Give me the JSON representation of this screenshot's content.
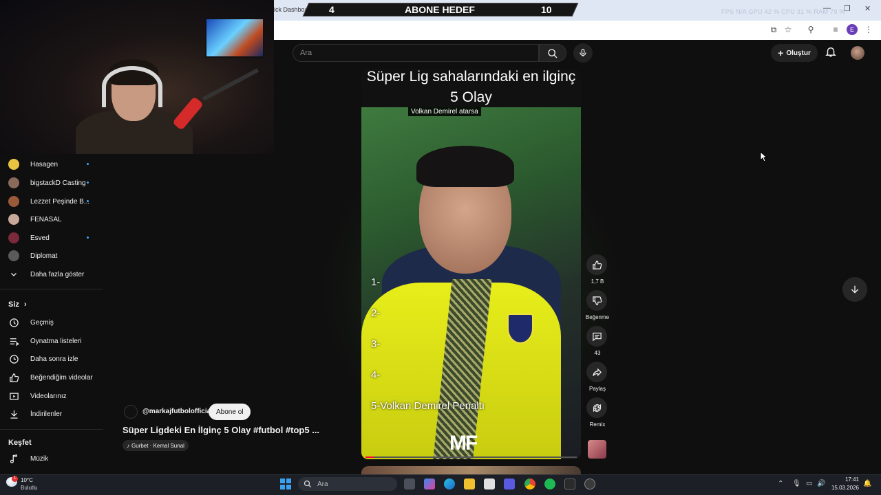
{
  "browser": {
    "tab_title": "ick Dashboard",
    "window_controls": [
      "—",
      "❐",
      "✕"
    ]
  },
  "overlay": {
    "abone": {
      "left": "4",
      "label": "ABONE HEDEF",
      "right": "10"
    },
    "perf": "FPS N/A    GPU 42 %    CPU 31 %    RAM 79 %"
  },
  "header": {
    "search_placeholder": "Ara",
    "create_label": "Oluştur"
  },
  "sidebar": {
    "subscriptions": [
      {
        "name": "Hasagen",
        "color": "#e8c440",
        "new": true
      },
      {
        "name": "bigstackD Casting",
        "color": "#8a6a5a",
        "new": true
      },
      {
        "name": "Lezzet Peşinde B...",
        "color": "#9a5a3a",
        "new": true
      },
      {
        "name": "FENASAL",
        "color": "#c8a89a",
        "new": false
      },
      {
        "name": "Esved",
        "color": "#7a2a3a",
        "new": true
      },
      {
        "name": "Diplomat",
        "color": "#5a5a5a",
        "new": false
      }
    ],
    "show_more": "Daha fazla göster",
    "you_heading": "Siz",
    "you_items": [
      {
        "label": "Geçmiş",
        "icon": "history-icon"
      },
      {
        "label": "Oynatma listeleri",
        "icon": "playlists-icon"
      },
      {
        "label": "Daha sonra izle",
        "icon": "watch-later-icon"
      },
      {
        "label": "Beğendiğim videolar",
        "icon": "liked-icon"
      },
      {
        "label": "Videolarınız",
        "icon": "your-videos-icon"
      },
      {
        "label": "İndirilenler",
        "icon": "downloads-icon"
      }
    ],
    "explore_heading": "Keşfet",
    "explore_items": [
      {
        "label": "Müzik",
        "icon": "music-icon"
      }
    ]
  },
  "short": {
    "title_line1": "Süper Lig sahalarındaki en ilginç",
    "title_line2": "5 Olay",
    "overlay_label": "Volkan Demirel atarsa",
    "ranks": [
      "1-",
      "2-",
      "3-",
      "4-",
      "5-Volkan Demirel Penaltı"
    ],
    "logo": "MF",
    "progress": 0.04
  },
  "actions": {
    "likes": "1,7 B",
    "dislike": "Beğenme",
    "comments": "43",
    "share": "Paylaş",
    "remix": "Remix"
  },
  "channel": {
    "handle": "@markajfutbolofficial",
    "subscribe": "Abone ol",
    "video_title": "Süper Ligdeki En İlginç 5 Olay #futbol #top5 ...",
    "sound": "Gurbet · Kemal Sunal"
  },
  "taskbar": {
    "weather_badge": "1",
    "temp": "10°C",
    "condition": "Bulutlu",
    "search_placeholder": "Ara",
    "time": "17:41",
    "date": "15.03.2026"
  }
}
